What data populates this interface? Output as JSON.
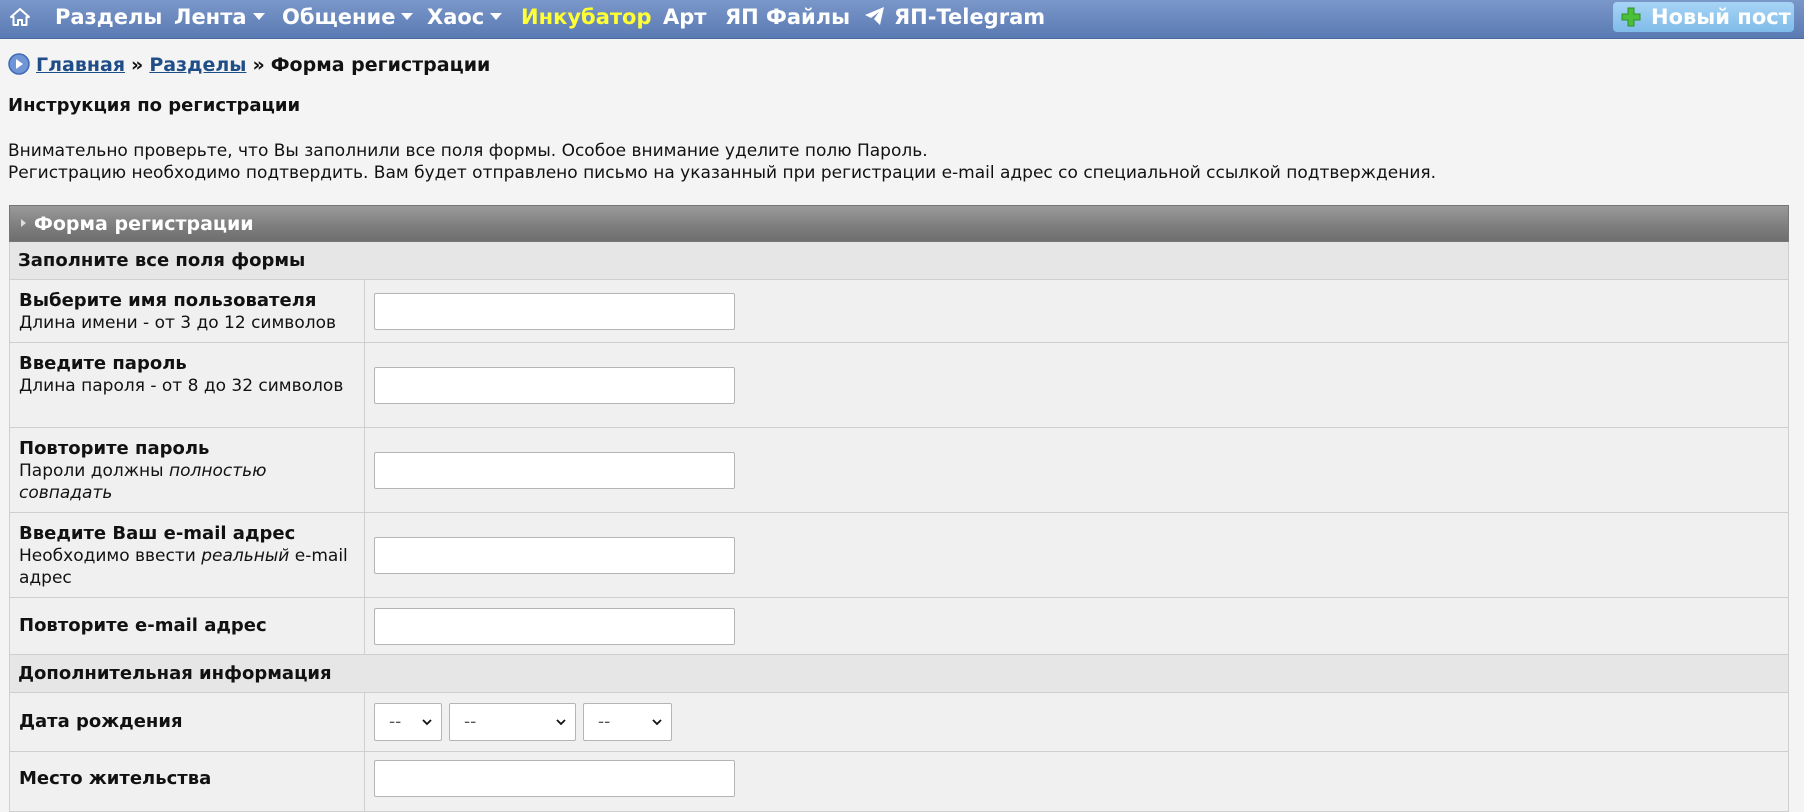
{
  "nav": {
    "items": [
      {
        "label": "Разделы",
        "caret": false,
        "highlight": false
      },
      {
        "label": "Лента",
        "caret": true,
        "highlight": false
      },
      {
        "label": "Общение",
        "caret": true,
        "highlight": false
      },
      {
        "label": "Хаос",
        "caret": true,
        "highlight": false
      },
      {
        "label": "Инкубатор",
        "caret": false,
        "highlight": true
      },
      {
        "label": "Арт",
        "caret": false,
        "highlight": false
      },
      {
        "label": "ЯП Файлы",
        "caret": false,
        "highlight": false
      },
      {
        "label": "ЯП-Telegram",
        "caret": false,
        "highlight": false
      }
    ],
    "new_post": "Новый пост",
    "colors": {
      "bar": "#6a88be",
      "highlight": "#ffff33",
      "new_post_bg": "#8cc6ef"
    }
  },
  "breadcrumb": {
    "home": "Главная",
    "sections": "Разделы",
    "current": "Форма регистрации",
    "separator": "»"
  },
  "instructions": {
    "title": "Инструкция по регистрации",
    "line1": "Внимательно проверьте, что Вы заполнили все поля формы. Особое внимание уделите полю Пароль.",
    "line2": "Регистрацию необходимо подтвердить. Вам будет отправлено письмо на указанный при регистрации e-mail адрес со специальной ссылкой подтверждения."
  },
  "form": {
    "header": "Форма регистрации",
    "section_main": "Заполните все поля формы",
    "username": {
      "label": "Выберите имя пользователя",
      "hint": "Длина имени - от 3 до 12 символов",
      "value": ""
    },
    "password": {
      "label": "Введите пароль",
      "hint": "Длина пароля - от 8 до 32 символов",
      "value": ""
    },
    "password_repeat": {
      "label": "Повторите пароль",
      "hint_prefix": "Пароли должны ",
      "hint_em": "полностью совпадать",
      "value": ""
    },
    "email": {
      "label": "Введите Ваш e-mail адрес",
      "hint_prefix": "Необходимо ввести ",
      "hint_em": "реальный",
      "hint_suffix": " e-mail адрес",
      "value": ""
    },
    "email_repeat": {
      "label": "Повторите e-mail адрес",
      "value": ""
    },
    "section_extra": "Дополнительная информация",
    "birthdate": {
      "label": "Дата рождения",
      "day": "--",
      "month": "--",
      "year": "--"
    },
    "location": {
      "label": "Место жительства",
      "value": ""
    }
  }
}
